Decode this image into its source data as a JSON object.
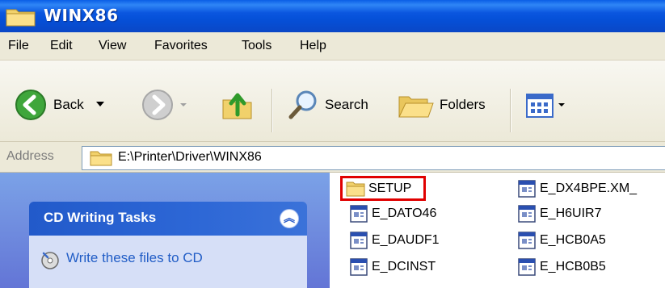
{
  "window": {
    "title": "WINX86"
  },
  "menu": [
    "File",
    "Edit",
    "View",
    "Favorites",
    "Tools",
    "Help"
  ],
  "toolbar": {
    "back_label": "Back",
    "search_label": "Search",
    "folders_label": "Folders"
  },
  "address": {
    "label": "Address",
    "value": "E:\\Printer\\Driver\\WINX86"
  },
  "tasks": {
    "title": "CD Writing Tasks",
    "collapse_glyph": "︽",
    "link": "Write these files to CD"
  },
  "files": {
    "col1": [
      "SETUP",
      "E_DATO46",
      "E_DAUDF1",
      "E_DCINST"
    ],
    "col2": [
      "E_DX4BPE.XM_",
      "E_H6UIR7",
      "E_HCB0A5",
      "E_HCB0B5"
    ]
  },
  "colors": {
    "highlight": "#e00000",
    "title_bar": "#0a56df",
    "link": "#215dc6"
  }
}
